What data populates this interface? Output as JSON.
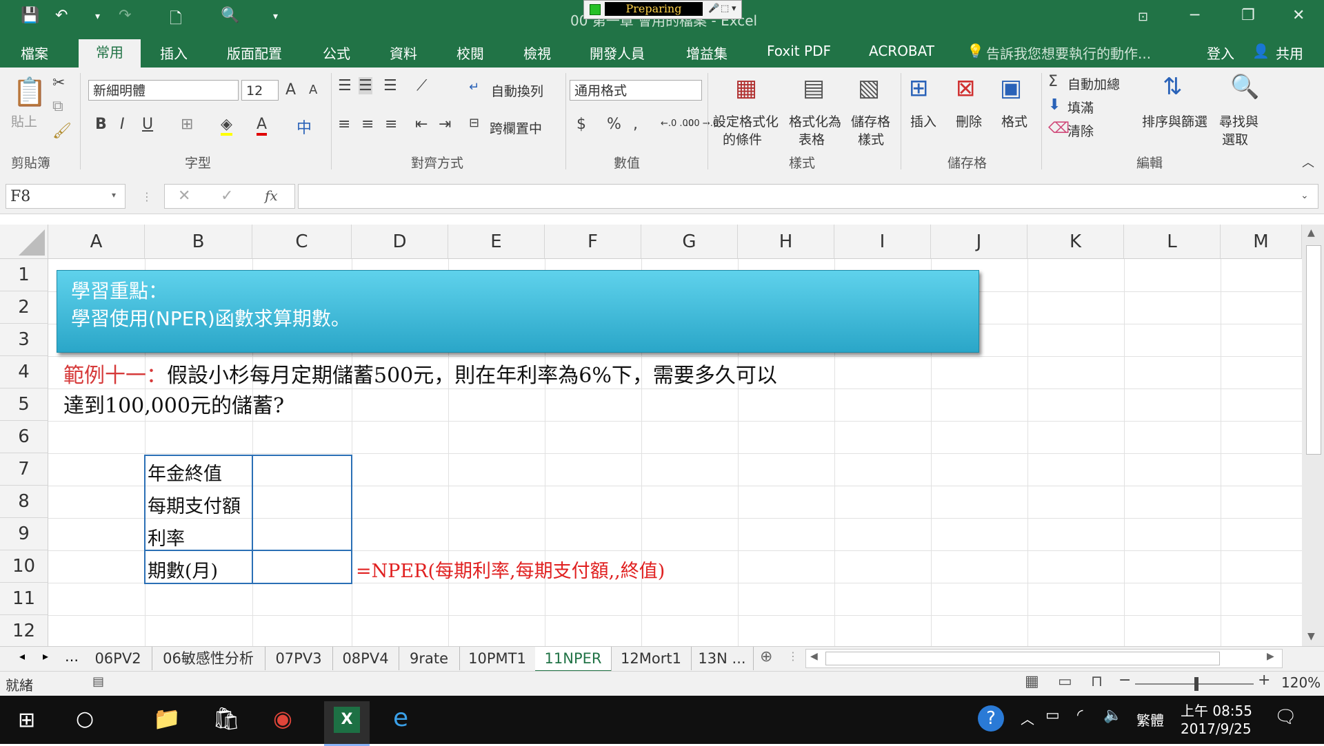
{
  "titlebar": {
    "doc_title": "00 第一章 會用的檔案 - Excel",
    "recorder_label": "Preparing",
    "qa_dropdown": "▾"
  },
  "ribbon_tabs": [
    "檔案",
    "常用",
    "插入",
    "版面配置",
    "公式",
    "資料",
    "校閱",
    "檢視",
    "開發人員",
    "增益集",
    "Foxit PDF",
    "ACROBAT"
  ],
  "tell_me": "告訴我您想要執行的動作...",
  "signin": "登入",
  "share": "共用",
  "ribbon": {
    "paste": "貼上",
    "clipboard": "剪貼簿",
    "font_name": "新細明體",
    "font_size": "12",
    "font_group": "字型",
    "bold": "B",
    "italic": "I",
    "underline": "U",
    "wrap_text": "自動換列",
    "merge_center": "跨欄置中",
    "alignment_group": "對齊方式",
    "number_format": "通用格式",
    "number_group": "數值",
    "currency": "$",
    "percent": "%",
    "comma": ",",
    "inc_decimal": "←.0 .00",
    "dec_decimal": ".00 →.0",
    "cond_format": [
      "設定格式化",
      "的條件"
    ],
    "format_table": [
      "格式化為",
      "表格"
    ],
    "cell_styles": [
      "儲存格",
      "樣式"
    ],
    "styles_group": "樣式",
    "insert": "插入",
    "delete": "刪除",
    "format": "格式",
    "cells_group": "儲存格",
    "autosum": "自動加總",
    "fill": "填滿",
    "clear": "清除",
    "sort_filter": "排序與篩選",
    "find_select": [
      "尋找與",
      "選取"
    ],
    "editing_group": "編輯"
  },
  "formula_bar": {
    "name_box": "F8",
    "fx": "fx",
    "value": ""
  },
  "columns": [
    "A",
    "B",
    "C",
    "D",
    "E",
    "F",
    "G",
    "H",
    "I",
    "J",
    "K",
    "L",
    "M"
  ],
  "rows": [
    "1",
    "2",
    "3",
    "4",
    "5",
    "6",
    "7",
    "8",
    "9",
    "10",
    "11",
    "12"
  ],
  "callout": {
    "line1": "學習重點：",
    "line2": "學習使用(NPER)函數求算期數。"
  },
  "example": {
    "prefix": "範例十一：",
    "line1": "假設小杉每月定期儲蓄500元，則在年利率為6%下，需要多久可以",
    "line2": "達到100,000元的儲蓄?"
  },
  "table": {
    "labels": [
      "年金終值",
      "每期支付額",
      "利率",
      "期數(月)"
    ],
    "formula_hint": "=NPER(每期利率,每期支付額,,終值)"
  },
  "sheet_tabs": [
    "06PV2",
    "06敏感性分析",
    "07PV3",
    "08PV4",
    "9rate",
    "10PMT1",
    "11NPER",
    "12Mort1",
    "13N ..."
  ],
  "active_sheet": "11NPER",
  "status": {
    "ready": "就緒",
    "zoom": "120%"
  },
  "taskbar": {
    "ime": "繁體",
    "time": "上午 08:55",
    "date": "2017/9/25"
  },
  "colors": {
    "excel_green": "#217346",
    "callout_blue": "#3bbfe0",
    "red_text": "#d63a3a",
    "table_border": "#2a6fb5"
  }
}
